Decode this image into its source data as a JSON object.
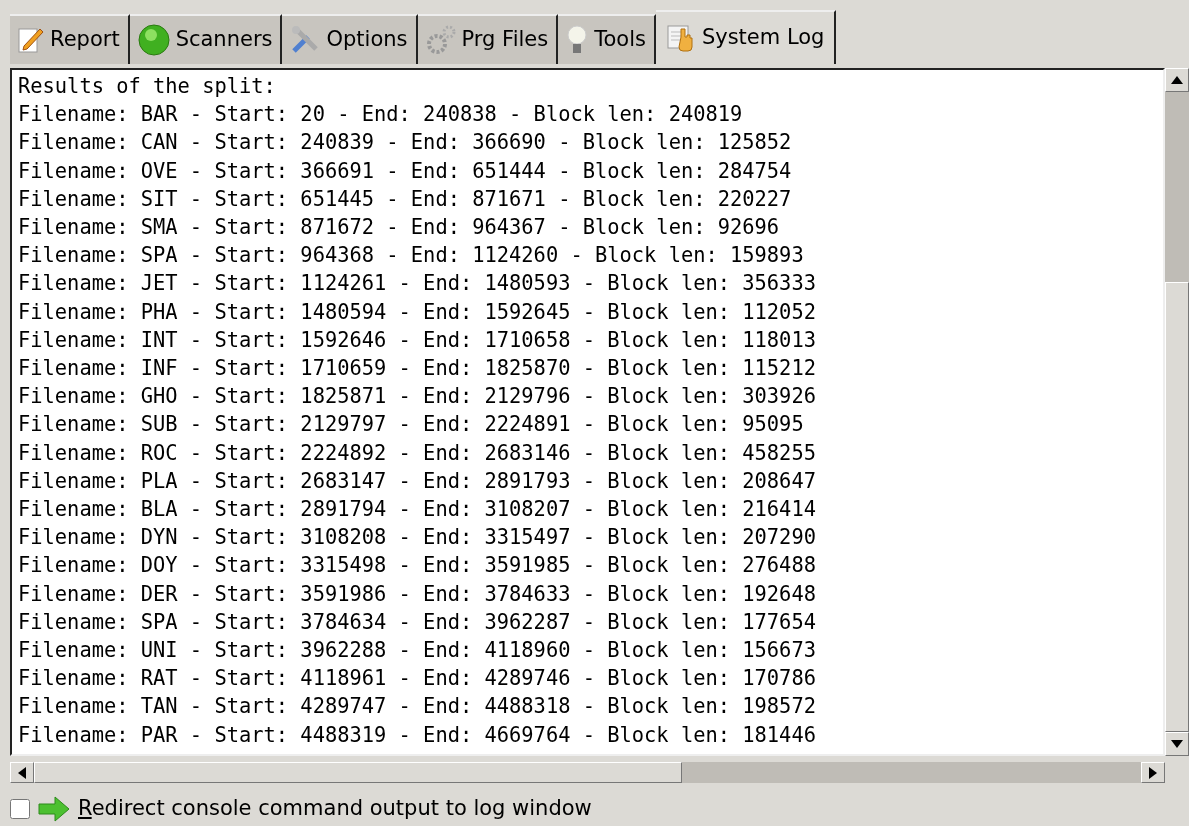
{
  "tabs": [
    {
      "label": "Report",
      "selected": false
    },
    {
      "label": "Scanners",
      "selected": false
    },
    {
      "label": "Options",
      "selected": false
    },
    {
      "label": "Prg Files",
      "selected": false
    },
    {
      "label": "Tools",
      "selected": false
    },
    {
      "label": "System Log",
      "selected": true
    }
  ],
  "log_lines": [
    "Results of the split:",
    "Filename: BAR - Start: 20 - End: 240838 - Block len: 240819",
    "Filename: CAN - Start: 240839 - End: 366690 - Block len: 125852",
    "Filename: OVE - Start: 366691 - End: 651444 - Block len: 284754",
    "Filename: SIT - Start: 651445 - End: 871671 - Block len: 220227",
    "Filename: SMA - Start: 871672 - End: 964367 - Block len: 92696",
    "Filename: SPA - Start: 964368 - End: 1124260 - Block len: 159893",
    "Filename: JET - Start: 1124261 - End: 1480593 - Block len: 356333",
    "Filename: PHA - Start: 1480594 - End: 1592645 - Block len: 112052",
    "Filename: INT - Start: 1592646 - End: 1710658 - Block len: 118013",
    "Filename: INF - Start: 1710659 - End: 1825870 - Block len: 115212",
    "Filename: GHO - Start: 1825871 - End: 2129796 - Block len: 303926",
    "Filename: SUB - Start: 2129797 - End: 2224891 - Block len: 95095",
    "Filename: ROC - Start: 2224892 - End: 2683146 - Block len: 458255",
    "Filename: PLA - Start: 2683147 - End: 2891793 - Block len: 208647",
    "Filename: BLA - Start: 2891794 - End: 3108207 - Block len: 216414",
    "Filename: DYN - Start: 3108208 - End: 3315497 - Block len: 207290",
    "Filename: DOY - Start: 3315498 - End: 3591985 - Block len: 276488",
    "Filename: DER - Start: 3591986 - End: 3784633 - Block len: 192648",
    "Filename: SPA - Start: 3784634 - End: 3962287 - Block len: 177654",
    "Filename: UNI - Start: 3962288 - End: 4118960 - Block len: 156673",
    "Filename: RAT - Start: 4118961 - End: 4289746 - Block len: 170786",
    "Filename: TAN - Start: 4289747 - End: 4488318 - Block len: 198572",
    "Filename: PAR - Start: 4488319 - End: 4669764 - Block len: 181446"
  ],
  "redirect_option": {
    "label": "Redirect console command output to log window",
    "checked": false
  }
}
